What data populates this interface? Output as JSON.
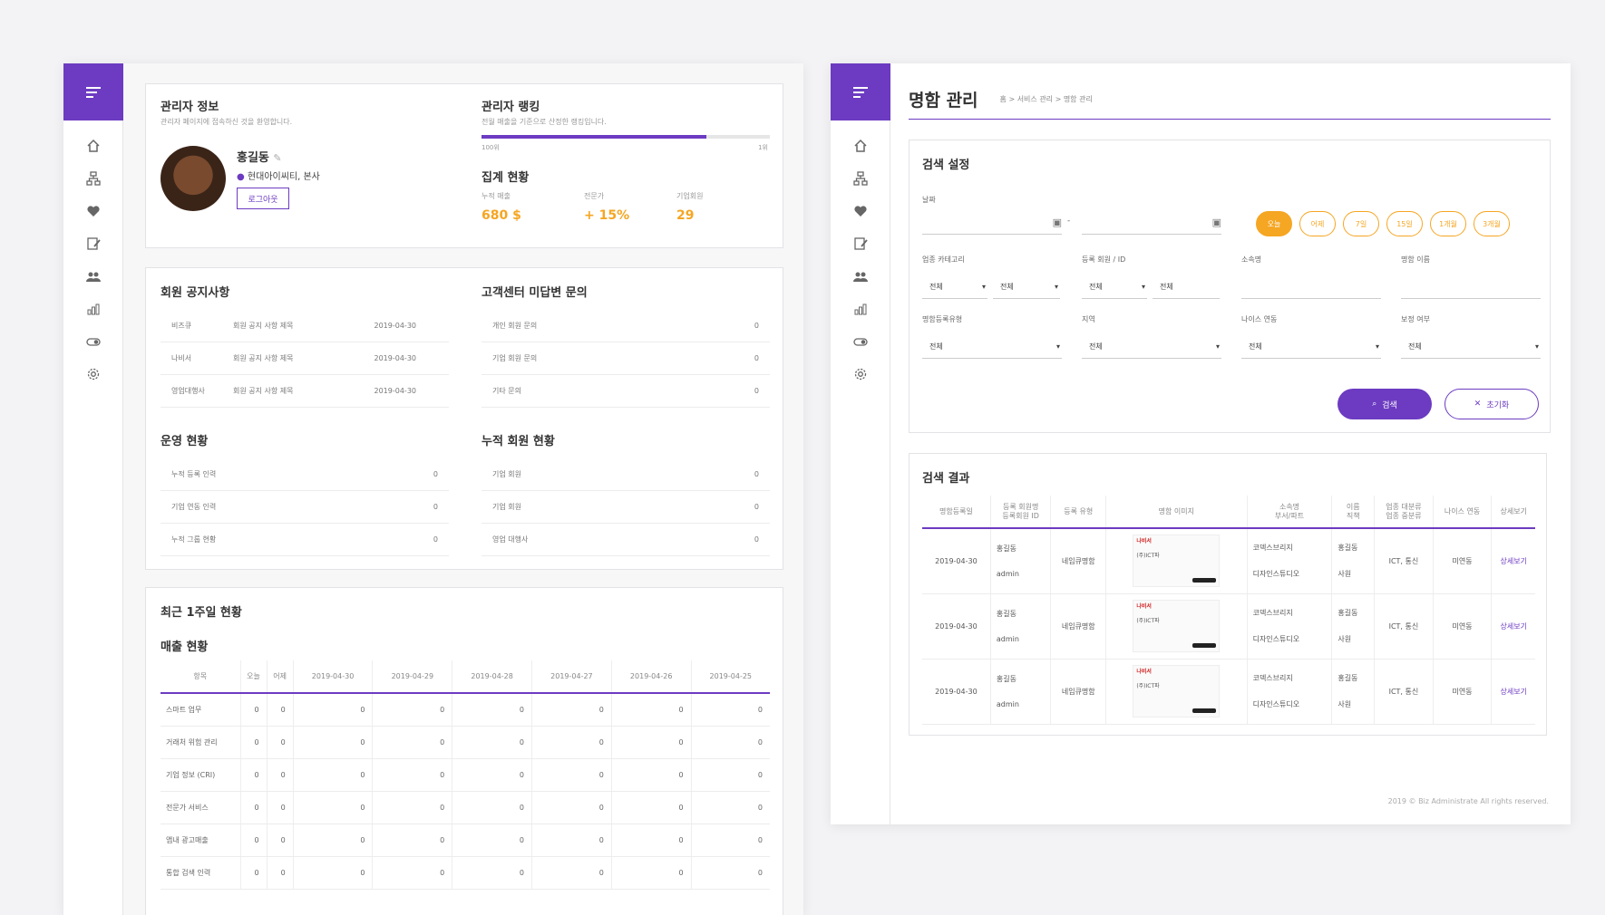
{
  "dashboard": {
    "admin_info": {
      "title": "관리자 정보",
      "subtitle": "관리자 페이지에 접속하신 것을 환영합니다.",
      "name": "홍길동",
      "org": "현대아이씨티, 본사",
      "logout_label": "로그아웃"
    },
    "ranking": {
      "title": "관리자 랭킹",
      "subtitle": "전월 매출을 기준으로 산정한 랭킹입니다.",
      "left_label": "100위",
      "right_label": "1위",
      "progress": 0.78
    },
    "summary": {
      "title": "집계 현황",
      "stats": [
        {
          "label": "누적 매출",
          "value": "680 $"
        },
        {
          "label": "전문가",
          "value": "+ 15%"
        },
        {
          "label": "기업회원",
          "value": "29"
        }
      ]
    },
    "notice": {
      "title": "회원 공지사항",
      "rows": [
        {
          "type": "비즈큐",
          "title": "회원 공지 사항 제목",
          "date": "2019-04-30"
        },
        {
          "type": "나비서",
          "title": "회원 공지 사항 제목",
          "date": "2019-04-30"
        },
        {
          "type": "영업대행사",
          "title": "회원 공지 사항 제목",
          "date": "2019-04-30"
        }
      ]
    },
    "inquiry": {
      "title": "고객센터 미답변 문의",
      "rows": [
        {
          "label": "개인 회원 문의",
          "value": "0"
        },
        {
          "label": "기업 회원 문의",
          "value": "0"
        },
        {
          "label": "기타 문의",
          "value": "0"
        }
      ]
    },
    "operation": {
      "title": "운영 현황",
      "rows": [
        {
          "label": "누적 등록 인력",
          "value": "0"
        },
        {
          "label": "기업 연동 인력",
          "value": "0"
        },
        {
          "label": "누적 그룹 현황",
          "value": "0"
        }
      ]
    },
    "members": {
      "title": "누적 회원 현황",
      "rows": [
        {
          "label": "기업 회원",
          "value": "0"
        },
        {
          "label": "기업 회원",
          "value": "0"
        },
        {
          "label": "영업 대행사",
          "value": "0"
        }
      ]
    },
    "weekly": {
      "title": "최근 1주일 현황",
      "subtitle": "매출 현황",
      "headers": [
        "항목",
        "오늘",
        "어제",
        "2019-04-30",
        "2019-04-29",
        "2019-04-28",
        "2019-04-27",
        "2019-04-26",
        "2019-04-25"
      ],
      "rows": [
        [
          "스마트 업무",
          "0",
          "0",
          "0",
          "0",
          "0",
          "0",
          "0",
          "0"
        ],
        [
          "거래처 위험 관리",
          "0",
          "0",
          "0",
          "0",
          "0",
          "0",
          "0",
          "0"
        ],
        [
          "기업 정보 (CRI)",
          "0",
          "0",
          "0",
          "0",
          "0",
          "0",
          "0",
          "0"
        ],
        [
          "전문가 서비스",
          "0",
          "0",
          "0",
          "0",
          "0",
          "0",
          "0",
          "0"
        ],
        [
          "앱내 광고매출",
          "0",
          "0",
          "0",
          "0",
          "0",
          "0",
          "0",
          "0"
        ],
        [
          "통합 검색 인력",
          "0",
          "0",
          "0",
          "0",
          "0",
          "0",
          "0",
          "0"
        ]
      ]
    }
  },
  "cardmgmt": {
    "title": "명함 관리",
    "breadcrumb": "홈 > 서비스 관리 > 명함 관리",
    "search": {
      "title": "검색 설정",
      "date_label": "날짜",
      "date_sep": "-",
      "quick": [
        "오늘",
        "어제",
        "7일",
        "15일",
        "1개월",
        "3개월"
      ],
      "row1": [
        {
          "label": "업종 카테고리",
          "a": "전체",
          "b": "전체"
        },
        {
          "label": "등록 회원 / ID",
          "a": "전체",
          "b": "전체"
        },
        {
          "label": "소속명"
        },
        {
          "label": "명함 이름"
        }
      ],
      "row2": [
        {
          "label": "명함등록유형",
          "value": "전체"
        },
        {
          "label": "지역",
          "value": "전체"
        },
        {
          "label": "나이스 연동",
          "value": "전체"
        },
        {
          "label": "보정 여부",
          "value": "전체"
        }
      ],
      "search_label": "검색",
      "reset_label": "초기화"
    },
    "result": {
      "title": "검색 결과",
      "headers": [
        "명함등록일",
        "등록 회원명\n등록회원 ID",
        "등록 유형",
        "명함 이미지",
        "소속명\n부서/파트",
        "이름\n직책",
        "업종 대분류\n업종 중분류",
        "나이스 연동",
        "상세보기"
      ],
      "card_brand": "나비서",
      "card_company": "(주)ICT파",
      "rows": [
        {
          "date": "2019-04-30",
          "member": "홍길동",
          "id": "admin",
          "type": "네임큐명함",
          "org": "코덱스브리지",
          "dept": "디자인스튜디오",
          "name": "홍길동",
          "pos": "사원",
          "ind": "ICT, 통신",
          "nice": "미연동",
          "detail": "상세보기"
        },
        {
          "date": "2019-04-30",
          "member": "홍길동",
          "id": "admin",
          "type": "네임큐명함",
          "org": "코덱스브리지",
          "dept": "디자인스튜디오",
          "name": "홍길동",
          "pos": "사원",
          "ind": "ICT, 통신",
          "nice": "미연동",
          "detail": "상세보기"
        },
        {
          "date": "2019-04-30",
          "member": "홍길동",
          "id": "admin",
          "type": "네임큐명함",
          "org": "코덱스브리지",
          "dept": "디자인스튜디오",
          "name": "홍길동",
          "pos": "사원",
          "ind": "ICT, 통신",
          "nice": "미연동",
          "detail": "상세보기"
        }
      ]
    },
    "footer": "2019 © Biz Administrate All rights reserved."
  },
  "colors": {
    "accent": "#6c3bc1",
    "orange": "#f5a623"
  }
}
